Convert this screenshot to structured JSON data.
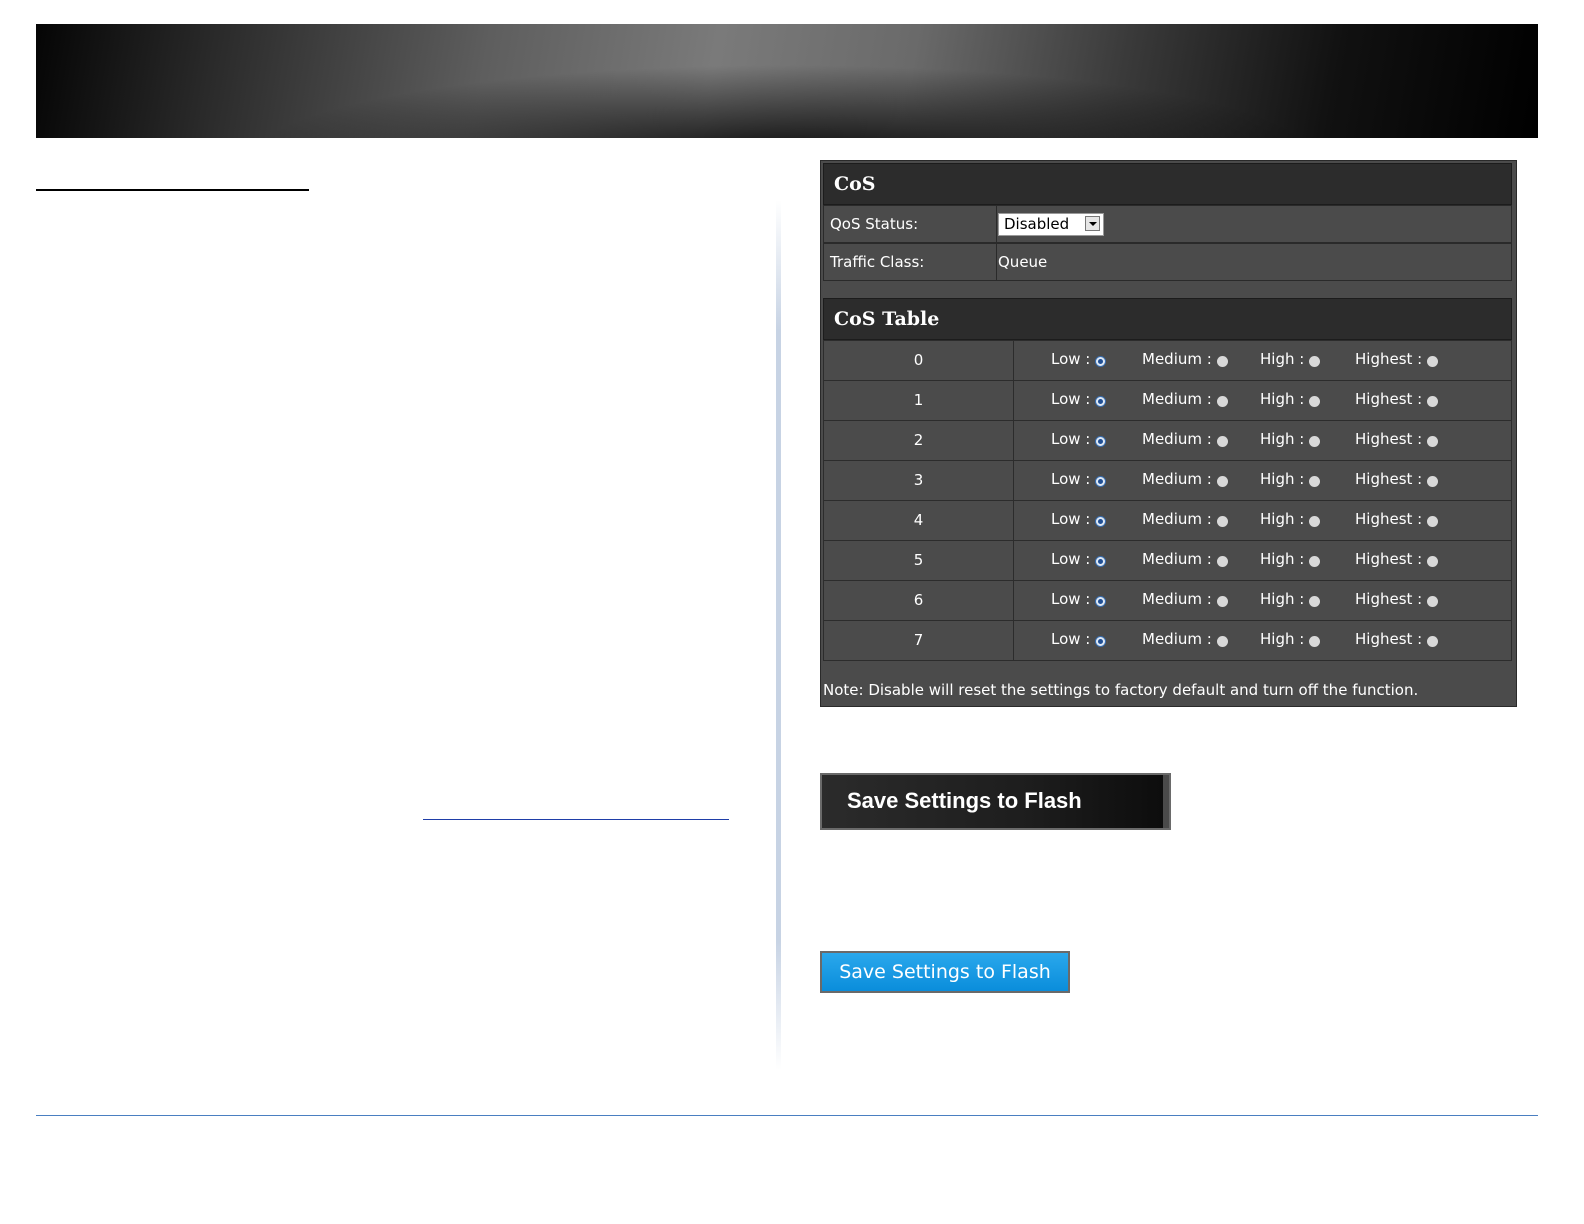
{
  "cos_panel": {
    "title": "CoS",
    "qos_status_label": "QoS Status:",
    "qos_status_value": "Disabled",
    "traffic_class_label": "Traffic Class:",
    "traffic_class_value": "Queue"
  },
  "cos_table": {
    "title": "CoS Table",
    "option_labels": [
      "Low :",
      "Medium :",
      "High :",
      "Highest :"
    ],
    "rows": [
      {
        "priority": "0",
        "selected": "Low"
      },
      {
        "priority": "1",
        "selected": "Low"
      },
      {
        "priority": "2",
        "selected": "Low"
      },
      {
        "priority": "3",
        "selected": "Low"
      },
      {
        "priority": "4",
        "selected": "Low"
      },
      {
        "priority": "5",
        "selected": "Low"
      },
      {
        "priority": "6",
        "selected": "Low"
      },
      {
        "priority": "7",
        "selected": "Low"
      }
    ]
  },
  "note": "Note: Disable will reset the settings to factory default and turn off the function.",
  "buttons": {
    "save_dark_label": "Save Settings to Flash",
    "save_blue_label": "Save Settings to Flash"
  },
  "colors": {
    "panel_bg": "#4b4b4b",
    "header_bg": "#2c2c2c",
    "blue_button": "#0a8ddb",
    "footer_rule": "#4a7fc1"
  }
}
